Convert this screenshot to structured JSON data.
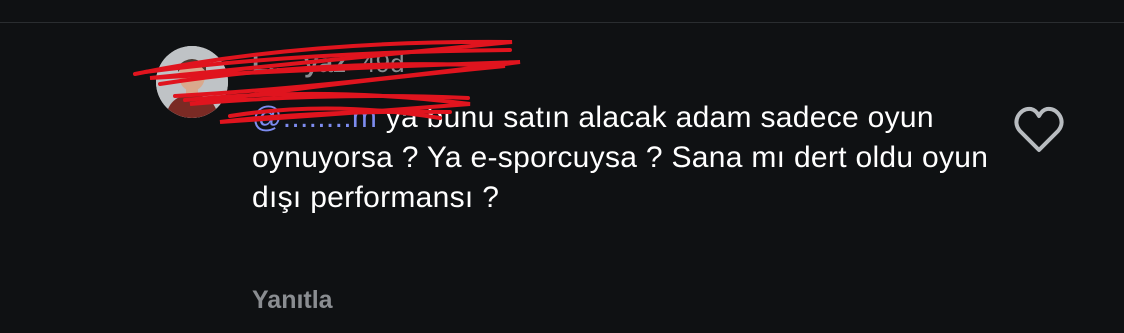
{
  "comment": {
    "username": "L.....yaz",
    "time_ago": "49d",
    "mention": "@........m",
    "text": " ya bunu satın alacak adam sadece oyun oynuyorsa ? Ya e-sporcuysa ? Sana mı dert oldu oyun dışı performansı ?",
    "reply_label": "Yanıtla"
  },
  "icons": {
    "like": "heart-outline-icon",
    "avatar": "profile-photo"
  },
  "colors": {
    "background": "#0f1113",
    "text": "#ffffff",
    "muted": "#8a8d91",
    "mention": "#7d8cf0",
    "redaction": "#e0141e"
  }
}
